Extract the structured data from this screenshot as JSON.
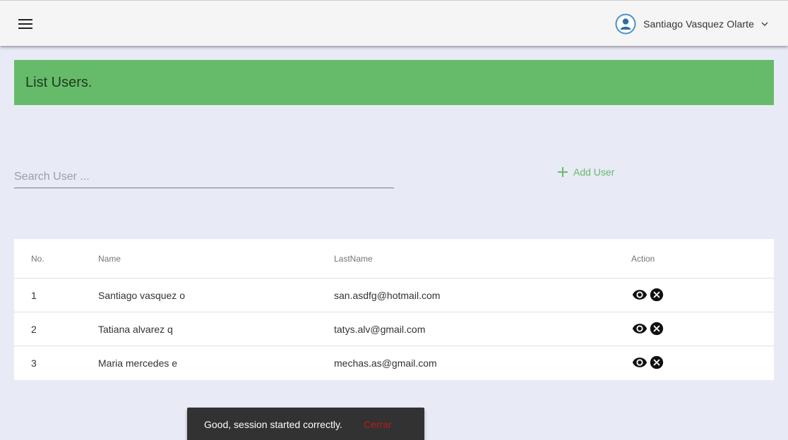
{
  "header": {
    "menu_icon": "hamburger-menu-icon",
    "user_name": "Santiago Vasquez Olarte",
    "avatar_icon": "account-circle-icon",
    "dropdown_icon": "chevron-down-icon"
  },
  "banner": {
    "title": "List Users.",
    "color": "#66bb6a"
  },
  "search": {
    "placeholder": "Search User ...",
    "value": ""
  },
  "add_user": {
    "label": "Add User",
    "icon": "plus-icon",
    "color": "#66bb6a"
  },
  "table": {
    "headers": [
      "No.",
      "Name",
      "LastName",
      "Action"
    ],
    "rows": [
      {
        "no": "1",
        "name": "Santiago vasquez o",
        "email": "san.asdfg@hotmail.com"
      },
      {
        "no": "2",
        "name": "Tatiana alvarez q",
        "email": "tatys.alv@gmail.com"
      },
      {
        "no": "3",
        "name": "Maria mercedes e",
        "email": "mechas.as@gmail.com"
      }
    ],
    "action_icons": [
      "eye-icon",
      "close-circle-icon"
    ]
  },
  "snackbar": {
    "message": "Good, session started correctly.",
    "action": "Cerrar"
  },
  "colors": {
    "background": "#e8eaf6",
    "toolbar": "#f5f5f5",
    "snackbar": "#323232",
    "snackbar_action": "#b71c1c"
  }
}
